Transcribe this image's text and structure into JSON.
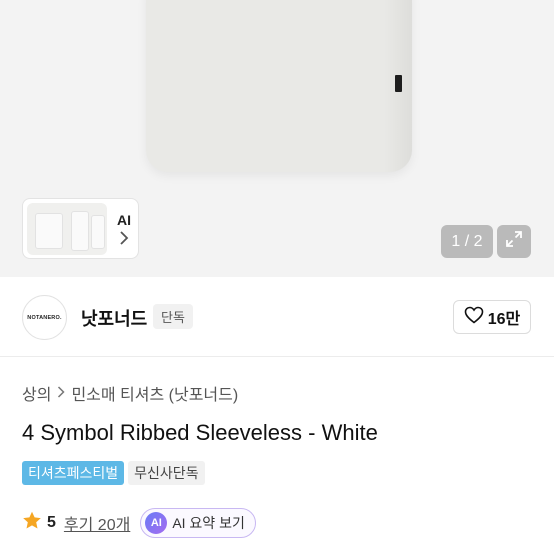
{
  "hero": {
    "ai_card": {
      "label": "AI",
      "chevron": "chevron-right-icon"
    },
    "image_counter": "1 / 2",
    "expand_icon": "expand-icon"
  },
  "brand": {
    "logo_text": "NOTANERO.",
    "name": "낫포너드",
    "badge": "단독",
    "like_count": "16만",
    "like_icon": "heart-outline-icon"
  },
  "breadcrumb": {
    "items": [
      "상의",
      "민소매 티셔츠 (낫포너드)"
    ],
    "separator_icon": "chevron-right-icon"
  },
  "product": {
    "title": "4 Symbol Ribbed Sleeveless - White",
    "tags": [
      "티셔츠페스티벌",
      "무신사단독"
    ]
  },
  "rating": {
    "score": "5",
    "reviews": "후기 20개",
    "star_icon": "star-icon",
    "star_color": "#f5a623",
    "ai_summary": {
      "badge": "AI",
      "label": "AI 요약 보기"
    }
  },
  "colors": {
    "festival_tag": "#5db8e6",
    "ai_border": "#c8b8f2"
  }
}
